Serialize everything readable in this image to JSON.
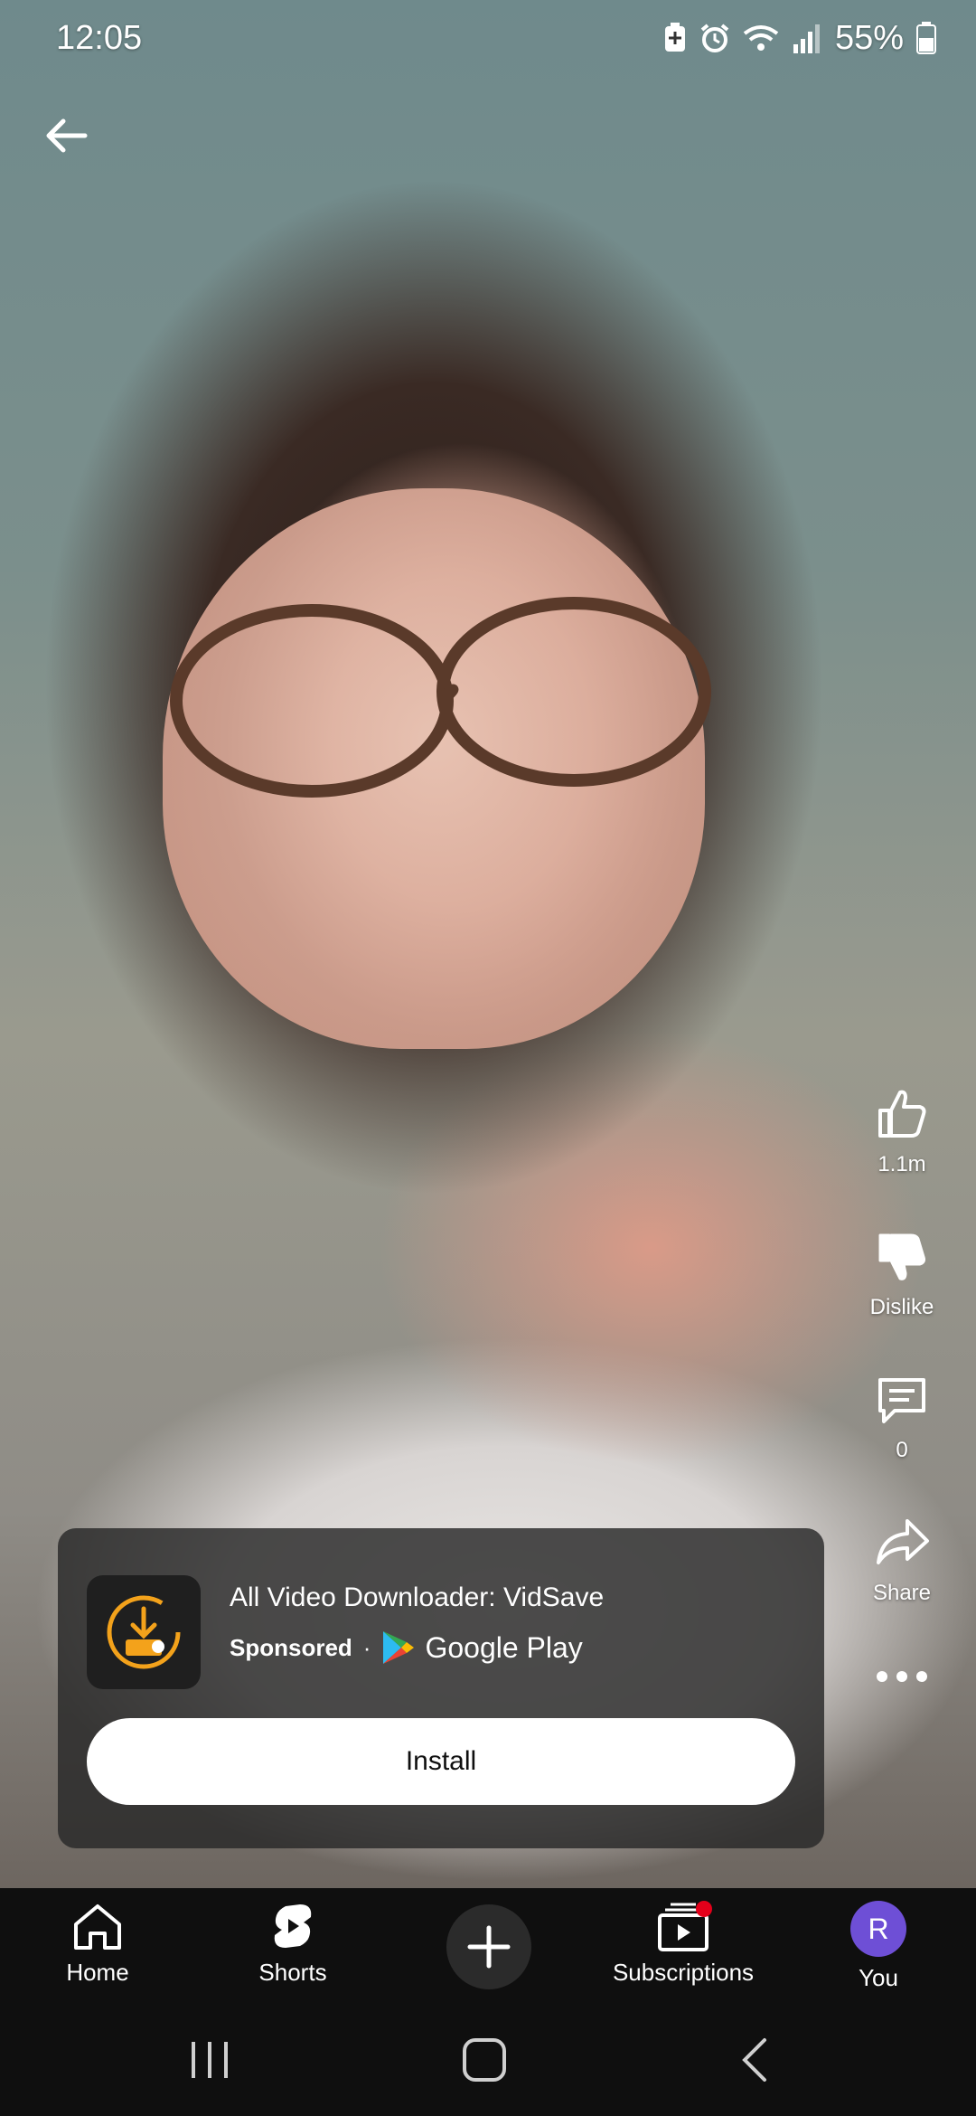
{
  "status_bar": {
    "time": "12:05",
    "battery": "55%",
    "icons": [
      "battery-saver-icon",
      "alarm-icon",
      "wifi-icon",
      "signal-icon",
      "battery-icon"
    ]
  },
  "actions": {
    "like_count": "1.1m",
    "dislike_label": "Dislike",
    "comment_count": "0",
    "share_label": "Share"
  },
  "ad": {
    "title": "All Video Downloader: VidSave",
    "sponsored": "Sponsored",
    "separator": "·",
    "store": "Google Play",
    "install_label": "Install",
    "icon_color": "#f3a21b"
  },
  "nav": {
    "home": "Home",
    "shorts": "Shorts",
    "subscriptions": "Subscriptions",
    "you": "You",
    "avatar_initial": "R",
    "avatar_color": "#6e4fd6"
  }
}
